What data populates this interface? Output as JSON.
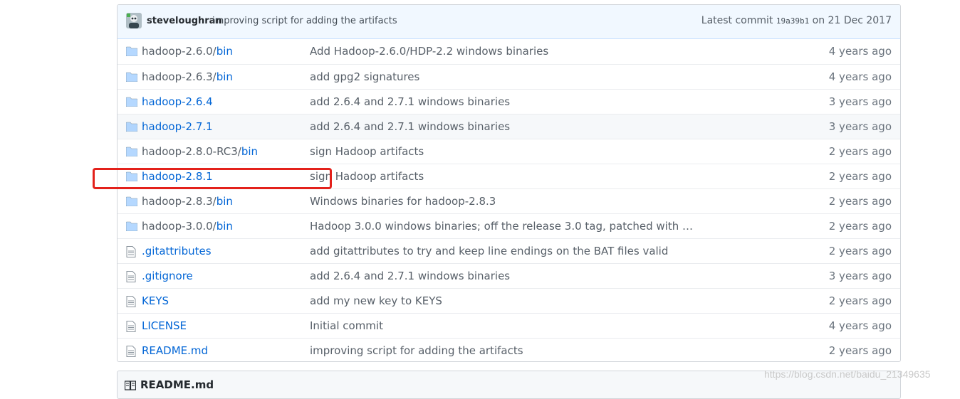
{
  "commit": {
    "author": "steveloughran",
    "message": "improving script for adding the artifacts",
    "latest_prefix": "Latest commit",
    "sha": "19a39b1",
    "date_text": "on 21 Dec 2017"
  },
  "files": [
    {
      "type": "dir",
      "name_main": "hadoop-2.6.0/",
      "name_link": "bin",
      "main_is_link": false,
      "message": "Add Hadoop-2.6.0/HDP-2.2 windows binaries",
      "age": "4 years ago"
    },
    {
      "type": "dir",
      "name_main": "hadoop-2.6.3/",
      "name_link": "bin",
      "main_is_link": false,
      "message": "add gpg2 signatures",
      "age": "4 years ago"
    },
    {
      "type": "dir",
      "name_main": "hadoop-2.6.4",
      "name_link": "",
      "main_is_link": true,
      "message": "add 2.6.4 and 2.7.1 windows binaries",
      "age": "3 years ago"
    },
    {
      "type": "dir",
      "name_main": "hadoop-2.7.1",
      "name_link": "",
      "main_is_link": true,
      "message": "add 2.6.4 and 2.7.1 windows binaries",
      "age": "3 years ago"
    },
    {
      "type": "dir",
      "name_main": "hadoop-2.8.0-RC3/",
      "name_link": "bin",
      "main_is_link": false,
      "message": "sign Hadoop artifacts",
      "age": "2 years ago"
    },
    {
      "type": "dir",
      "name_main": "hadoop-2.8.1",
      "name_link": "",
      "main_is_link": true,
      "message": "sign Hadoop artifacts",
      "age": "2 years ago"
    },
    {
      "type": "dir",
      "name_main": "hadoop-2.8.3/",
      "name_link": "bin",
      "main_is_link": false,
      "message": "Windows binaries for hadoop-2.8.3",
      "age": "2 years ago"
    },
    {
      "type": "dir",
      "name_main": "hadoop-3.0.0/",
      "name_link": "bin",
      "main_is_link": false,
      "message": "Hadoop 3.0.0 windows binaries; off the release 3.0 tag, patched with …",
      "age": "2 years ago"
    },
    {
      "type": "file",
      "name_main": ".gitattributes",
      "name_link": "",
      "main_is_link": true,
      "message": "add gitattributes to try and keep line endings on the BAT files valid",
      "age": "2 years ago"
    },
    {
      "type": "file",
      "name_main": ".gitignore",
      "name_link": "",
      "main_is_link": true,
      "message": "add 2.6.4 and 2.7.1 windows binaries",
      "age": "3 years ago"
    },
    {
      "type": "file",
      "name_main": "KEYS",
      "name_link": "",
      "main_is_link": true,
      "message": "add my new key to KEYS",
      "age": "2 years ago"
    },
    {
      "type": "file",
      "name_main": "LICENSE",
      "name_link": "",
      "main_is_link": true,
      "message": "Initial commit",
      "age": "4 years ago"
    },
    {
      "type": "file",
      "name_main": "README.md",
      "name_link": "",
      "main_is_link": true,
      "message": "improving script for adding the artifacts",
      "age": "2 years ago"
    }
  ],
  "readme": {
    "title": "README.md"
  },
  "watermark": "https://blog.csdn.net/baidu_21349635",
  "colors": {
    "link": "#0366d6",
    "highlight": "#e3211b",
    "folder": "#79b8ff"
  }
}
